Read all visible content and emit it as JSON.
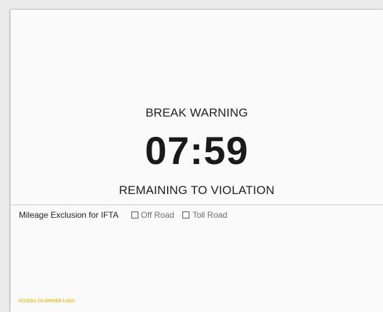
{
  "warning": {
    "title": "BREAK WARNING",
    "timer": "07:59",
    "subtitle": "REMAINING TO VIOLATION"
  },
  "mileage": {
    "label": "Mileage Exclusion for IFTA",
    "options": [
      {
        "label": "Off Road",
        "checked": false
      },
      {
        "label": "Toll Road",
        "checked": false
      }
    ]
  },
  "footer": {
    "link_label": "ACCESS CO-DRIVER LOGS",
    "link_color": "#f5b700"
  }
}
